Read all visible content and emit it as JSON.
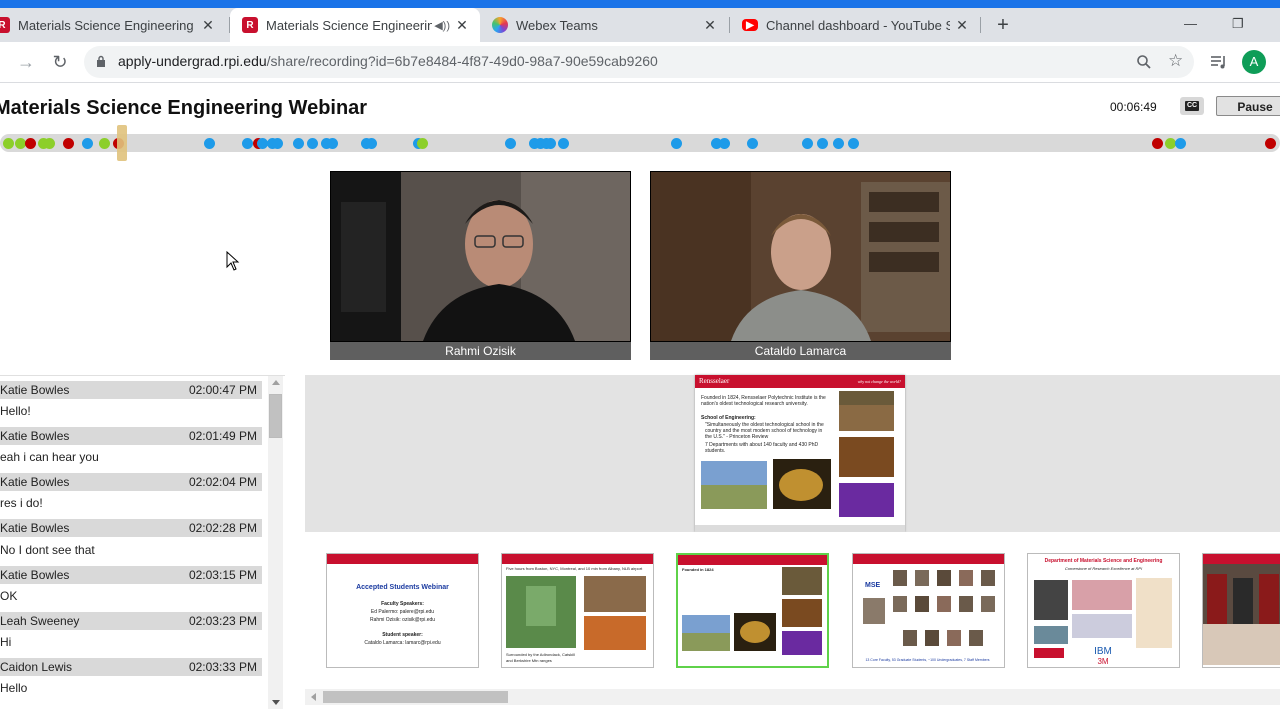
{
  "browser": {
    "tabs": [
      {
        "title": "Materials Science Engineering W",
        "favicon": "rpi-icon",
        "active": false
      },
      {
        "title": "Materials Science Engineerin",
        "favicon": "rpi-icon",
        "active": true,
        "audio": true
      },
      {
        "title": "Webex Teams",
        "favicon": "webex-icon",
        "active": false
      },
      {
        "title": "Channel dashboard - YouTube St",
        "favicon": "youtube-icon",
        "active": false
      }
    ],
    "url_host": "apply-undergrad.rpi.edu",
    "url_path": "/share/recording?id=6b7e8484-4f87-49d0-98a7-90e59cab9260",
    "profile_initial": "A"
  },
  "player": {
    "title": "Materials Science Engineering Webinar",
    "time": "00:06:49",
    "cc_label": "CC",
    "pause_label": "Pause",
    "progress_fraction": 0.095
  },
  "participants": [
    {
      "name": "Rahmi Ozisik"
    },
    {
      "name": "Cataldo Lamarca"
    }
  ],
  "chat": [
    {
      "name": "Katie Bowles",
      "time": "02:00:47 PM",
      "text": "Hello!"
    },
    {
      "name": "Katie Bowles",
      "time": "02:01:49 PM",
      "text": "eah i can hear you"
    },
    {
      "name": "Katie Bowles",
      "time": "02:02:04 PM",
      "text": "res i do!"
    },
    {
      "name": "Katie Bowles",
      "time": "02:02:28 PM",
      "text": "No I dont see that"
    },
    {
      "name": "Katie Bowles",
      "time": "02:03:15 PM",
      "text": "OK"
    },
    {
      "name": "Leah Sweeney",
      "time": "02:03:23 PM",
      "text": "Hi"
    },
    {
      "name": "Caidon Lewis",
      "time": "02:03:33 PM",
      "text": "Hello"
    }
  ],
  "slide": {
    "brand": "Rensselaer",
    "tag": "why not change the world?",
    "founded_text": "Founded in 1824, Rensselaer Polytechnic Institute is the nation's oldest technological research university.",
    "school_title": "School of Engineering:",
    "bullets": [
      "\"Simultaneously the oldest technological school in the country and the most modern school of technology in the U.S.\" - Princeton Review",
      "7 Departments with about 140 faculty and 430 PhD students."
    ]
  },
  "thumbnails": [
    {
      "title": "Accepted Students Webinar",
      "lines": [
        "Faculty Speakers:",
        "Ed Palermo: palere@rpi.edu",
        "Rahmi Ozisik: ozisik@rpi.edu",
        "Student speaker:",
        "Cataldo Lamarca: lamarc@rpi.edu"
      ]
    },
    {
      "title": "Five hours from Boston, NYC, Montreal, and 10 min from Albany, NLB airport",
      "lines": [
        "Surrounded by the Adirondack, Catskill and Berkshire Mtn ranges"
      ]
    },
    {
      "title": "Founded in 1824",
      "lines": []
    },
    {
      "title": "MSE",
      "lines": [
        "13 Core Faculty, 53 Graduate Students, ~100 Undergraduates, 7 Staff Members"
      ]
    },
    {
      "title": "Department of Materials Science and Engineering",
      "lines": [
        "Cornerstone of Research Excellence at RPI"
      ]
    },
    {
      "title": "",
      "lines": []
    }
  ],
  "colors": {
    "accent": "#1a73e8",
    "rpi_red": "#c8102e",
    "marker_blue": "#1e9be9",
    "marker_red": "#c00000",
    "marker_green": "#8ccf2a"
  }
}
